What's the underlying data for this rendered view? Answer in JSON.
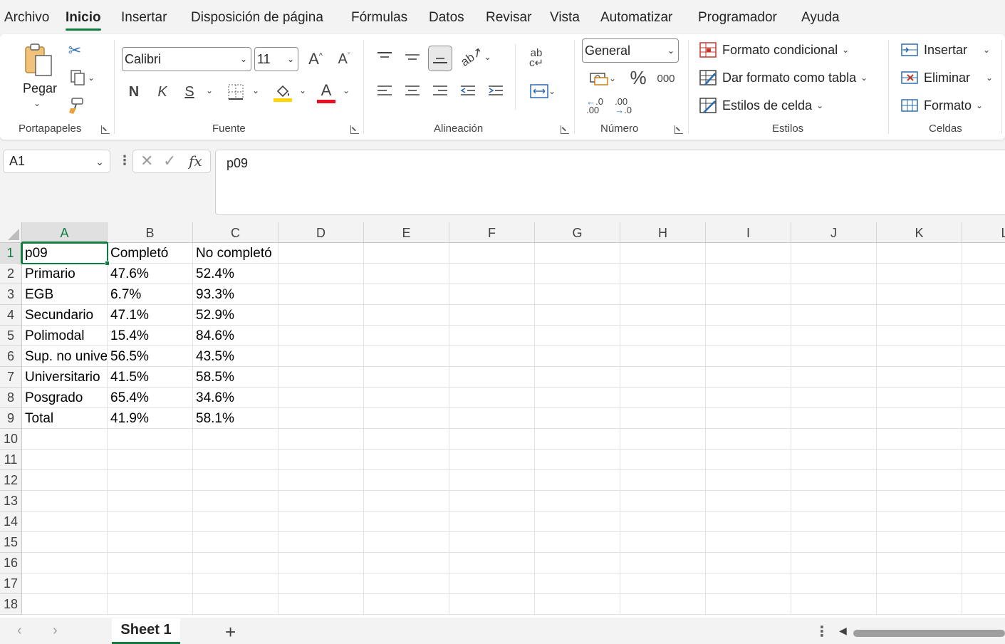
{
  "menu_tabs": [
    "Archivo",
    "Inicio",
    "Insertar",
    "Disposición de página",
    "Fórmulas",
    "Datos",
    "Revisar",
    "Vista",
    "Automatizar",
    "Programador",
    "Ayuda"
  ],
  "active_tab": "Inicio",
  "ribbon": {
    "clipboard": {
      "label": "Portapapeles",
      "paste": "Pegar"
    },
    "font": {
      "label": "Fuente",
      "family": "Calibri",
      "size": "11",
      "bold": "N",
      "italic": "K",
      "underline": "S",
      "fill_color": "#ffd700",
      "font_color": "#e81123"
    },
    "alignment": {
      "label": "Alineación"
    },
    "number": {
      "label": "Número",
      "format": "General",
      "percent": "%",
      "thousands": "000"
    },
    "styles": {
      "label": "Estilos",
      "conditional": "Formato condicional",
      "as_table": "Dar formato como tabla",
      "cell_styles": "Estilos de celda"
    },
    "cells": {
      "label": "Celdas",
      "insert": "Insertar",
      "delete": "Eliminar",
      "format": "Formato"
    }
  },
  "formula_bar": {
    "name_box": "A1",
    "fx": "fx",
    "content": "p09"
  },
  "columns": [
    "A",
    "B",
    "C",
    "D",
    "E",
    "F",
    "G",
    "H",
    "I",
    "J",
    "K",
    "L"
  ],
  "rows": [
    "1",
    "2",
    "3",
    "4",
    "5",
    "6",
    "7",
    "8",
    "9",
    "10",
    "11",
    "12",
    "13",
    "14",
    "15",
    "16",
    "17",
    "18"
  ],
  "table": [
    [
      "p09",
      "Completó",
      "No completó"
    ],
    [
      "Primario",
      "47.6%",
      "52.4%"
    ],
    [
      "EGB",
      "6.7%",
      "93.3%"
    ],
    [
      "Secundario",
      "47.1%",
      "52.9%"
    ],
    [
      "Polimodal",
      "15.4%",
      "84.6%"
    ],
    [
      "Sup. no universitario",
      "56.5%",
      "43.5%"
    ],
    [
      "Universitario",
      "41.5%",
      "58.5%"
    ],
    [
      "Posgrado",
      "65.4%",
      "34.6%"
    ],
    [
      "Total",
      "41.9%",
      "58.1%"
    ]
  ],
  "sheet_tab": "Sheet 1",
  "accent_color": "#107c41"
}
